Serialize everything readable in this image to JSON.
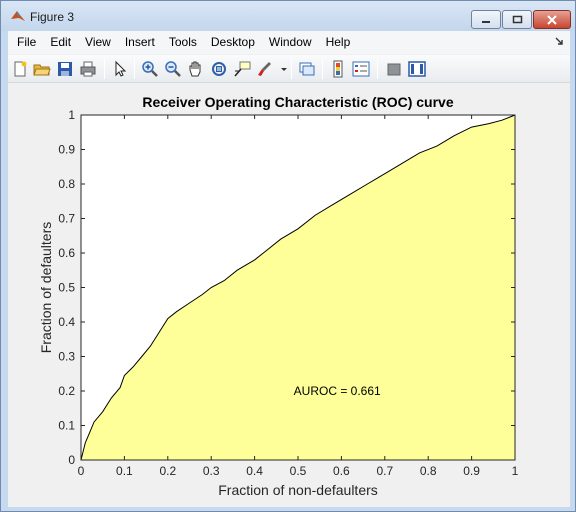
{
  "window": {
    "title": "Figure 3",
    "menu": [
      "File",
      "Edit",
      "View",
      "Insert",
      "Tools",
      "Desktop",
      "Window",
      "Help"
    ]
  },
  "toolbar": {
    "icons": [
      "new-figure-icon",
      "open-file-icon",
      "save-icon",
      "print-icon",
      "pointer-icon",
      "zoom-in-icon",
      "zoom-out-icon",
      "pan-icon",
      "rotate-3d-icon",
      "data-cursor-icon",
      "brush-icon",
      "link-plot-icon",
      "colorbar-icon",
      "legend-icon",
      "hide-plot-tools-icon",
      "show-plot-tools-icon"
    ]
  },
  "chart_data": {
    "type": "area",
    "title": "Receiver Operating Characteristic (ROC) curve",
    "xlabel": "Fraction of non-defaulters",
    "ylabel": "Fraction of defaulters",
    "xlim": [
      0,
      1
    ],
    "ylim": [
      0,
      1
    ],
    "xticks": [
      "0",
      "0.1",
      "0.2",
      "0.3",
      "0.4",
      "0.5",
      "0.6",
      "0.7",
      "0.8",
      "0.9",
      "1"
    ],
    "yticks": [
      "0",
      "0.1",
      "0.2",
      "0.3",
      "0.4",
      "0.5",
      "0.6",
      "0.7",
      "0.8",
      "0.9",
      "1"
    ],
    "annotation": "AUROC = 0.661",
    "annotation_at": [
      0.49,
      0.2
    ],
    "fill_color": "#ffff99",
    "grid": false,
    "x": [
      0,
      0.01,
      0.02,
      0.03,
      0.05,
      0.07,
      0.09,
      0.1,
      0.12,
      0.14,
      0.16,
      0.18,
      0.2,
      0.22,
      0.25,
      0.28,
      0.3,
      0.33,
      0.36,
      0.4,
      0.43,
      0.46,
      0.5,
      0.54,
      0.58,
      0.62,
      0.66,
      0.7,
      0.74,
      0.78,
      0.82,
      0.86,
      0.9,
      0.94,
      0.97,
      1.0
    ],
    "y": [
      0,
      0.05,
      0.08,
      0.11,
      0.14,
      0.18,
      0.21,
      0.245,
      0.27,
      0.3,
      0.33,
      0.37,
      0.41,
      0.43,
      0.455,
      0.48,
      0.5,
      0.52,
      0.55,
      0.58,
      0.61,
      0.64,
      0.67,
      0.71,
      0.74,
      0.77,
      0.8,
      0.83,
      0.86,
      0.89,
      0.91,
      0.94,
      0.965,
      0.975,
      0.985,
      1.0
    ]
  }
}
